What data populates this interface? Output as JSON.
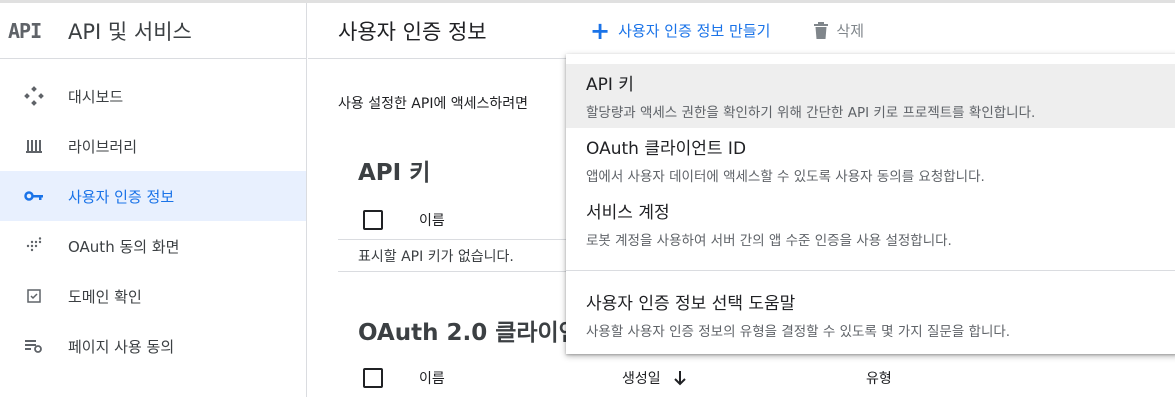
{
  "sidebar": {
    "logo": "API",
    "title": "API 및 서비스",
    "items": [
      {
        "label": "대시보드",
        "icon": "dashboard-icon"
      },
      {
        "label": "라이브러리",
        "icon": "library-icon"
      },
      {
        "label": "사용자 인증 정보",
        "icon": "key-icon",
        "active": true
      },
      {
        "label": "OAuth 동의 화면",
        "icon": "consent-screen-icon"
      },
      {
        "label": "도메인 확인",
        "icon": "checkbox-icon"
      },
      {
        "label": "페이지 사용 동의",
        "icon": "settings-list-icon"
      }
    ]
  },
  "header": {
    "title": "사용자 인증 정보",
    "create_label": "사용자 인증 정보 만들기",
    "delete_label": "삭제"
  },
  "main": {
    "description": "사용 설정한 API에 액세스하려면",
    "api_keys": {
      "title": "API 키",
      "col_name": "이름",
      "empty": "표시할 API 키가 없습니다."
    },
    "oauth": {
      "title": "OAuth 2.0 클라이언",
      "col_name": "이름",
      "col_created": "생성일",
      "col_type": "유형"
    }
  },
  "menu": {
    "items": [
      {
        "title": "API 키",
        "desc": "할당량과 액세스 권한을 확인하기 위해 간단한 API 키로 프로젝트를 확인합니다."
      },
      {
        "title": "OAuth 클라이언트 ID",
        "desc": "앱에서 사용자 데이터에 액세스할 수 있도록 사용자 동의를 요청합니다."
      },
      {
        "title": "서비스 계정",
        "desc": "로봇 계정을 사용하여 서버 간의 앱 수준 인증을 사용 설정합니다."
      }
    ],
    "wizard": {
      "title": "사용자 인증 정보 선택 도움말",
      "desc": "사용할 사용자 인증 정보의 유형을 결정할 수 있도록 몇 가지 질문을 합니다."
    }
  },
  "colors": {
    "accent": "#1a73e8",
    "active_bg": "#e8f0fe"
  }
}
